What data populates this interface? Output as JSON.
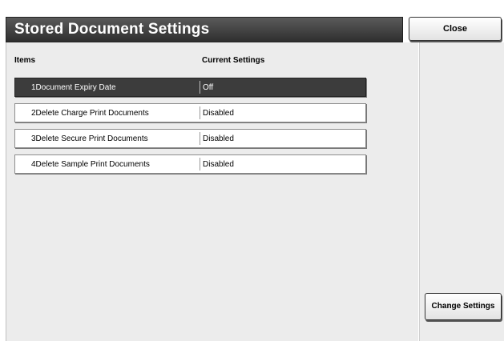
{
  "window": {
    "title": "Stored Document Settings"
  },
  "toolbar": {
    "close_label": "Close"
  },
  "table": {
    "headers": {
      "items": "Items",
      "current": "Current Settings"
    },
    "rows": [
      {
        "name": "1Document Expiry Date",
        "value": "Off",
        "selected": true
      },
      {
        "name": "2Delete Charge Print Documents",
        "value": "Disabled",
        "selected": false
      },
      {
        "name": "3Delete Secure Print Documents",
        "value": "Disabled",
        "selected": false
      },
      {
        "name": "4Delete Sample Print Documents",
        "value": "Disabled",
        "selected": false
      }
    ]
  },
  "actions": {
    "change_label": "Change Settings"
  },
  "colors": {
    "title_bg": "#3a3a3a",
    "panel_bg": "#ececec",
    "selected_row": "#3c3c3c"
  }
}
